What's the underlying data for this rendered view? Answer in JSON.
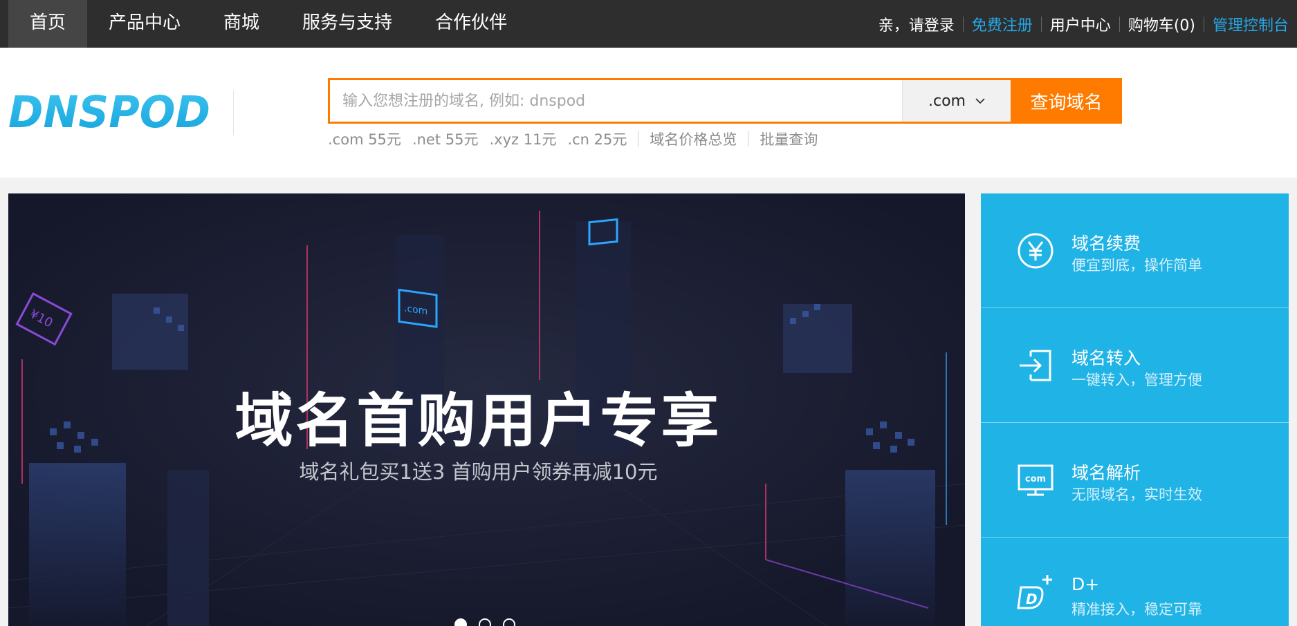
{
  "nav": {
    "items": [
      {
        "label": "首页"
      },
      {
        "label": "产品中心"
      },
      {
        "label": "商城"
      },
      {
        "label": "服务与支持"
      },
      {
        "label": "合作伙伴"
      }
    ],
    "active": "首页"
  },
  "user_links": {
    "login": "亲，请登录",
    "register": "免费注册",
    "user_center": "用户中心",
    "cart": "购物车(0)",
    "console": "管理控制台"
  },
  "logo": {
    "text": "DNSPOD"
  },
  "search": {
    "placeholder": "输入您想注册的域名, 例如: dnspod",
    "value": "",
    "suffix": ".com",
    "button": "查询域名"
  },
  "prices": [
    {
      "label": ".com 55元"
    },
    {
      "label": ".net 55元"
    },
    {
      "label": ".xyz 11元"
    },
    {
      "label": ".cn 25元"
    }
  ],
  "price_links": {
    "overview": "域名价格总览",
    "batch": "批量查询"
  },
  "banner": {
    "title": "域名首购用户专享",
    "subtitle": "域名礼包买1送3 首购用户领券再减10元",
    "decor_text": {
      "com": ".com",
      "coupon": "¥10"
    },
    "slides": 3,
    "active_slide": 1
  },
  "services": [
    {
      "title": "域名续费",
      "desc": "便宜到底，操作简单",
      "icon": "yen-icon"
    },
    {
      "title": "域名转入",
      "desc": "一键转入，管理方便",
      "icon": "transfer-in-icon"
    },
    {
      "title": "域名解析",
      "desc": "无限域名，实时生效",
      "icon": "com-monitor-icon"
    },
    {
      "title": "D+",
      "desc": "精准接入，稳定可靠",
      "icon": "d-plus-icon"
    }
  ],
  "colors": {
    "topbar": "#2e2e2e",
    "accent_orange": "#ff7b00",
    "accent_blue": "#20b3e6",
    "link_blue": "#25a8e6",
    "banner_bg": "#1a1c2d"
  }
}
